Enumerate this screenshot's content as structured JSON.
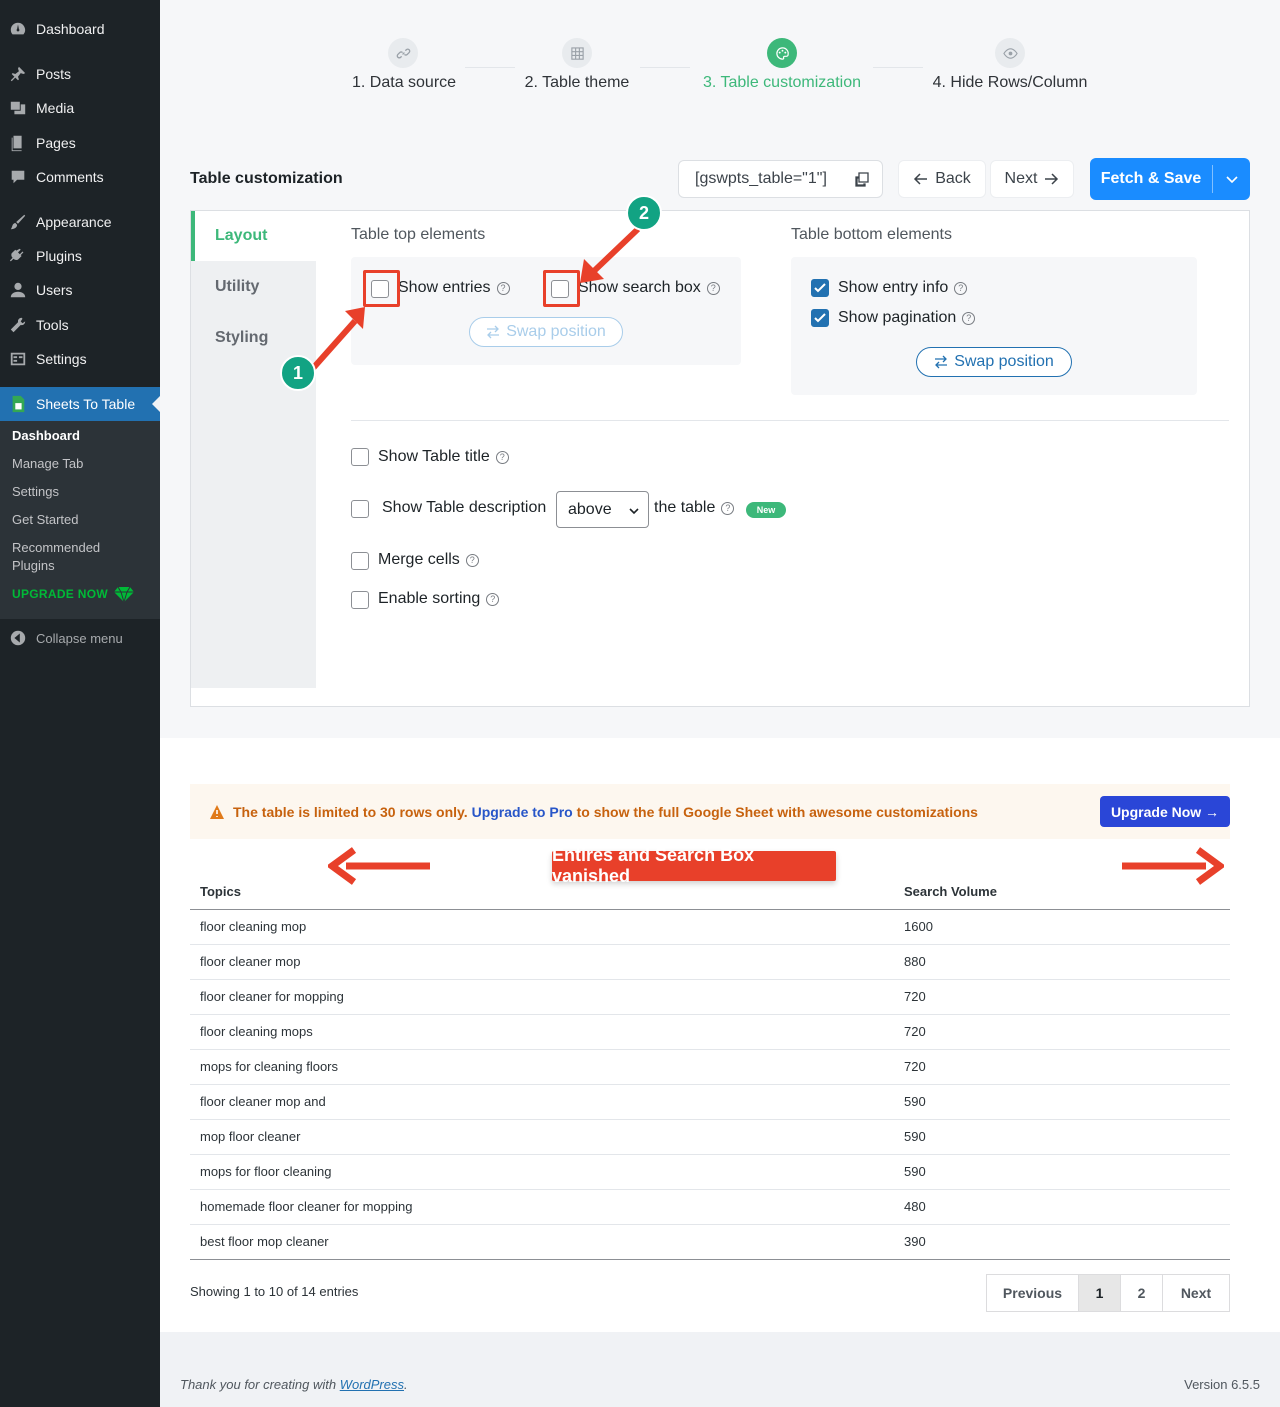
{
  "sidebar": {
    "items": [
      {
        "label": "Dashboard",
        "icon": "dashboard-icon"
      },
      {
        "label": "Posts",
        "icon": "pin-icon"
      },
      {
        "label": "Media",
        "icon": "media-icon"
      },
      {
        "label": "Pages",
        "icon": "pages-icon"
      },
      {
        "label": "Comments",
        "icon": "comment-icon"
      },
      {
        "label": "Appearance",
        "icon": "brush-icon"
      },
      {
        "label": "Plugins",
        "icon": "plug-icon"
      },
      {
        "label": "Users",
        "icon": "user-icon"
      },
      {
        "label": "Tools",
        "icon": "wrench-icon"
      },
      {
        "label": "Settings",
        "icon": "settings-icon"
      },
      {
        "label": "Sheets To Table",
        "icon": "sheets-icon"
      }
    ],
    "submenu": [
      "Dashboard",
      "Manage Tab",
      "Settings",
      "Get Started",
      "Recommended Plugins"
    ],
    "upgrade": "UPGRADE NOW",
    "collapse": "Collapse menu"
  },
  "stepper": {
    "steps": [
      "1. Data source",
      "2. Table theme",
      "3. Table customization",
      "4. Hide Rows/Column"
    ],
    "active_index": 2
  },
  "toolbar": {
    "heading": "Table customization",
    "shortcode": "[gswpts_table=\"1\"]",
    "back": "Back",
    "next": "Next",
    "fetch_save": "Fetch & Save"
  },
  "tabs": [
    "Layout",
    "Utility",
    "Styling"
  ],
  "layout": {
    "top_title": "Table top elements",
    "bottom_title": "Table bottom elements",
    "show_entries": "Show entries",
    "show_search": "Show search box",
    "show_entry_info": "Show entry info",
    "show_pagination": "Show pagination",
    "swap": "Swap position",
    "show_title": "Show Table title",
    "show_description": "Show Table description",
    "description_position": "above",
    "description_suffix": "the table",
    "new_badge": "New",
    "merge_cells": "Merge cells",
    "enable_sorting": "Enable sorting"
  },
  "annotations": {
    "marker_1": "1",
    "marker_2": "2",
    "vanished": "Entires and Search Box vanished"
  },
  "notice": {
    "text_before": "The table is limited to 30 rows only.",
    "link": "Upgrade to Pro",
    "text_after": "to show the full Google Sheet with awesome customizations",
    "button": "Upgrade Now →"
  },
  "table": {
    "headers": [
      "Topics",
      "Search Volume"
    ],
    "rows": [
      [
        "floor cleaning mop",
        "1600"
      ],
      [
        "floor cleaner mop",
        "880"
      ],
      [
        "floor cleaner for mopping",
        "720"
      ],
      [
        "floor cleaning mops",
        "720"
      ],
      [
        "mops for cleaning floors",
        "720"
      ],
      [
        "floor cleaner mop and",
        "590"
      ],
      [
        "mop floor cleaner",
        "590"
      ],
      [
        "mops for floor cleaning",
        "590"
      ],
      [
        "homemade floor cleaner for mopping",
        "480"
      ],
      [
        "best floor mop cleaner",
        "390"
      ]
    ],
    "info": "Showing 1 to 10 of 14 entries",
    "pager": [
      "Previous",
      "1",
      "2",
      "Next"
    ]
  },
  "footer": {
    "thanks_prefix": "Thank you for creating with",
    "thanks_link": "WordPress",
    "thanks_suffix": ".",
    "version": "Version 6.5.5"
  },
  "colors": {
    "accent_green": "#3db87a",
    "primary_blue": "#1a8cff",
    "annotation_red": "#e8402a",
    "wp_admin_dark": "#1d2327"
  }
}
